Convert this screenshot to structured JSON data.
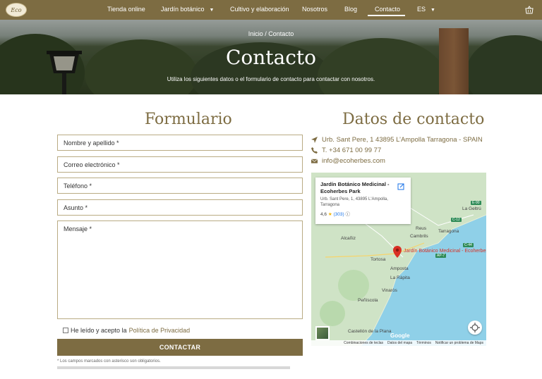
{
  "nav": {
    "logo_text": "Eco",
    "items": [
      {
        "label": "Tienda online",
        "has_dropdown": false
      },
      {
        "label": "Jardín botánico",
        "has_dropdown": true
      },
      {
        "label": "Cultivo y elaboración",
        "has_dropdown": false
      },
      {
        "label": "Nosotros",
        "has_dropdown": false
      },
      {
        "label": "Blog",
        "has_dropdown": false
      },
      {
        "label": "Contacto",
        "has_dropdown": false,
        "active": true
      },
      {
        "label": "ES",
        "has_dropdown": true
      }
    ],
    "cart_icon": "basket-icon"
  },
  "hero": {
    "breadcrumb": "Inicio / Contacto",
    "title": "Contacto",
    "subtitle": "Utiliza los siguientes datos o el formulario de contacto para contactar con nosotros."
  },
  "form": {
    "title": "Formulario",
    "fields": [
      {
        "placeholder": "Nombre y apellido *"
      },
      {
        "placeholder": "Correo electrónico *"
      },
      {
        "placeholder": "Teléfono *"
      },
      {
        "placeholder": "Asunto *"
      },
      {
        "placeholder": "Mensaje  *"
      }
    ],
    "consent_text": "He leído y acepto la",
    "consent_link": "Política de Privacidad",
    "submit_label": "CONTACTAR",
    "note": "* Los campos marcados con asterisco son obligatorios."
  },
  "contact": {
    "title": "Datos de contacto",
    "address": "Urb. Sant Pere, 1 43895 L’Ampolla Tarragona - SPAIN",
    "phone": "T. +34 671 00 99 77",
    "email": "info@ecoherbes.com",
    "icons": [
      "location-arrow-icon",
      "phone-icon",
      "envelope-icon"
    ]
  },
  "map": {
    "card_title": "Jardín Botánico Medicinal - Ecoherbes Park",
    "card_address": "Urb. Sant Pere, 1, 43895 L'Ampolla, Tarragona",
    "rating": "4,6",
    "reviews": "(303)",
    "pin_label": "Jardín Botánico Medicinal - Ecoherbes",
    "places": [
      "Alcañiz",
      "Reus",
      "Cambrils",
      "Tarragona",
      "Tortosa",
      "Amposta",
      "La Ràpita",
      "Vinaròs",
      "Peñíscola",
      "Castellón de la Plana",
      "La Geltrú"
    ],
    "roads": [
      "C-12",
      "AP-7",
      "C-44",
      "E-90"
    ],
    "google": "Google",
    "footer": [
      "Combinaciones de teclas",
      "Datos del mapa",
      "Términos",
      "Notificar un problema de Maps"
    ],
    "colors": {
      "sea": "#8fd0e8",
      "land": "#cfe3c6",
      "pin": "#d93025"
    }
  },
  "colors": {
    "brand": "#7d6c42",
    "nav_bg": "#7d6c42"
  }
}
